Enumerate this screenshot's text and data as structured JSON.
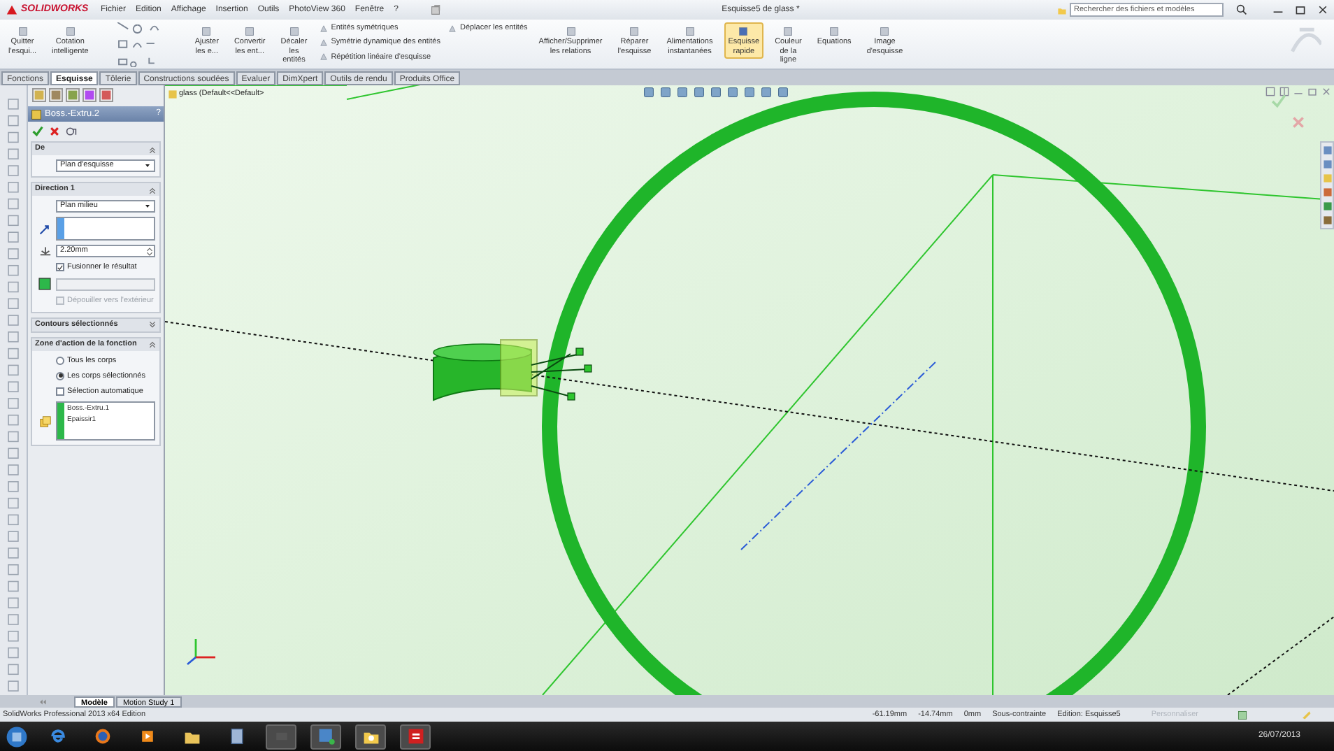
{
  "title_bar": {
    "logo": "SOLIDWORKS",
    "menus": [
      "Fichier",
      "Edition",
      "Affichage",
      "Insertion",
      "Outils",
      "PhotoView 360",
      "Fenêtre",
      "?"
    ],
    "title": "Esquisse5 de glass *",
    "search": {
      "placeholder": "Rechercher des fichiers et modèles"
    }
  },
  "ribbon": [
    {
      "kind": "large",
      "lines": [
        "Quitter",
        "l'esqui..."
      ]
    },
    {
      "kind": "large",
      "lines": [
        "Cotation",
        "intelligente"
      ]
    },
    {
      "kind": "tools"
    },
    {
      "kind": "large",
      "lines": [
        "Ajuster",
        "les e..."
      ]
    },
    {
      "kind": "large",
      "lines": [
        "Convertir",
        "les ent..."
      ]
    },
    {
      "kind": "large",
      "lines": [
        "Décaler",
        "les",
        "entités"
      ]
    },
    {
      "kind": "small",
      "items": [
        "Entités symétriques",
        "Symétrie dynamique des entités",
        "Répétition linéaire d'esquisse"
      ]
    },
    {
      "kind": "small",
      "items": [
        "Déplacer les entités"
      ]
    },
    {
      "kind": "large",
      "lines": [
        "Afficher/Supprimer",
        "les relations"
      ]
    },
    {
      "kind": "large",
      "lines": [
        "Réparer",
        "l'esquisse"
      ]
    },
    {
      "kind": "large",
      "lines": [
        "Alimentations",
        "instantanées"
      ]
    },
    {
      "kind": "large",
      "lines": [
        "Esquisse",
        "rapide"
      ],
      "selected": true
    },
    {
      "kind": "large",
      "lines": [
        "Couleur",
        "de la",
        "ligne"
      ],
      "selected": false
    },
    {
      "kind": "large",
      "lines": [
        "Equations"
      ]
    },
    {
      "kind": "large",
      "lines": [
        "Image",
        "d'esquisse"
      ]
    }
  ],
  "command_tabs": [
    {
      "label": "Fonctions",
      "selected": false
    },
    {
      "label": "Esquisse",
      "selected": true
    },
    {
      "label": "Tôlerie",
      "selected": false
    },
    {
      "label": "Constructions soudées",
      "selected": false
    },
    {
      "label": "Evaluer",
      "selected": false
    },
    {
      "label": "DimXpert",
      "selected": false
    },
    {
      "label": "Outils de rendu",
      "selected": false
    },
    {
      "label": "Produits Office",
      "selected": false
    }
  ],
  "property_manager": {
    "title": "Boss.-Extru.2",
    "help": "?",
    "sections": [
      {
        "title": "De",
        "expanded": true,
        "rows": [
          {
            "kind": "dropdown",
            "value": "Plan d'esquisse"
          }
        ]
      },
      {
        "title": "Direction 1",
        "expanded": true,
        "rows": [
          {
            "kind": "dropdown",
            "value": "Plan milieu"
          },
          {
            "kind": "listbox"
          },
          {
            "kind": "spinner",
            "value": "2.20mm"
          },
          {
            "kind": "checkbox",
            "label": "Fusionner le résultat",
            "checked": true,
            "disabled": false
          },
          {
            "kind": "colorfield"
          },
          {
            "kind": "checkbox",
            "label": "Dépouiller vers l'extérieur",
            "checked": false,
            "disabled": true
          }
        ]
      },
      {
        "title": "Contours sélectionnés",
        "expanded": false
      },
      {
        "title": "Zone d'action de la fonction",
        "expanded": true,
        "rows": [
          {
            "kind": "radio",
            "label": "Tous les corps",
            "selected": false
          },
          {
            "kind": "radio",
            "label": "Les corps sélectionnés",
            "selected": true
          },
          {
            "kind": "checkbox",
            "label": "Sélection automatique",
            "checked": false,
            "disabled": false
          },
          {
            "kind": "bodylist",
            "items": [
              "Boss.-Extru.1",
              "Epaissir1"
            ]
          }
        ]
      }
    ]
  },
  "tree_path": "glass (Default<<Default>",
  "bottom_tabs": [
    {
      "label": "Modèle",
      "selected": true
    },
    {
      "label": "Motion Study 1",
      "selected": false
    }
  ],
  "status_bar": {
    "product": "SolidWorks Professional 2013 x64 Edition",
    "x": "-61.19mm",
    "y": "-14.74mm",
    "z": "0mm",
    "state": "Sous-contrainte",
    "editing": "Edition: Esquisse5",
    "customize": "Personnaliser"
  },
  "taskbar": {
    "date": "26/07/2013"
  }
}
